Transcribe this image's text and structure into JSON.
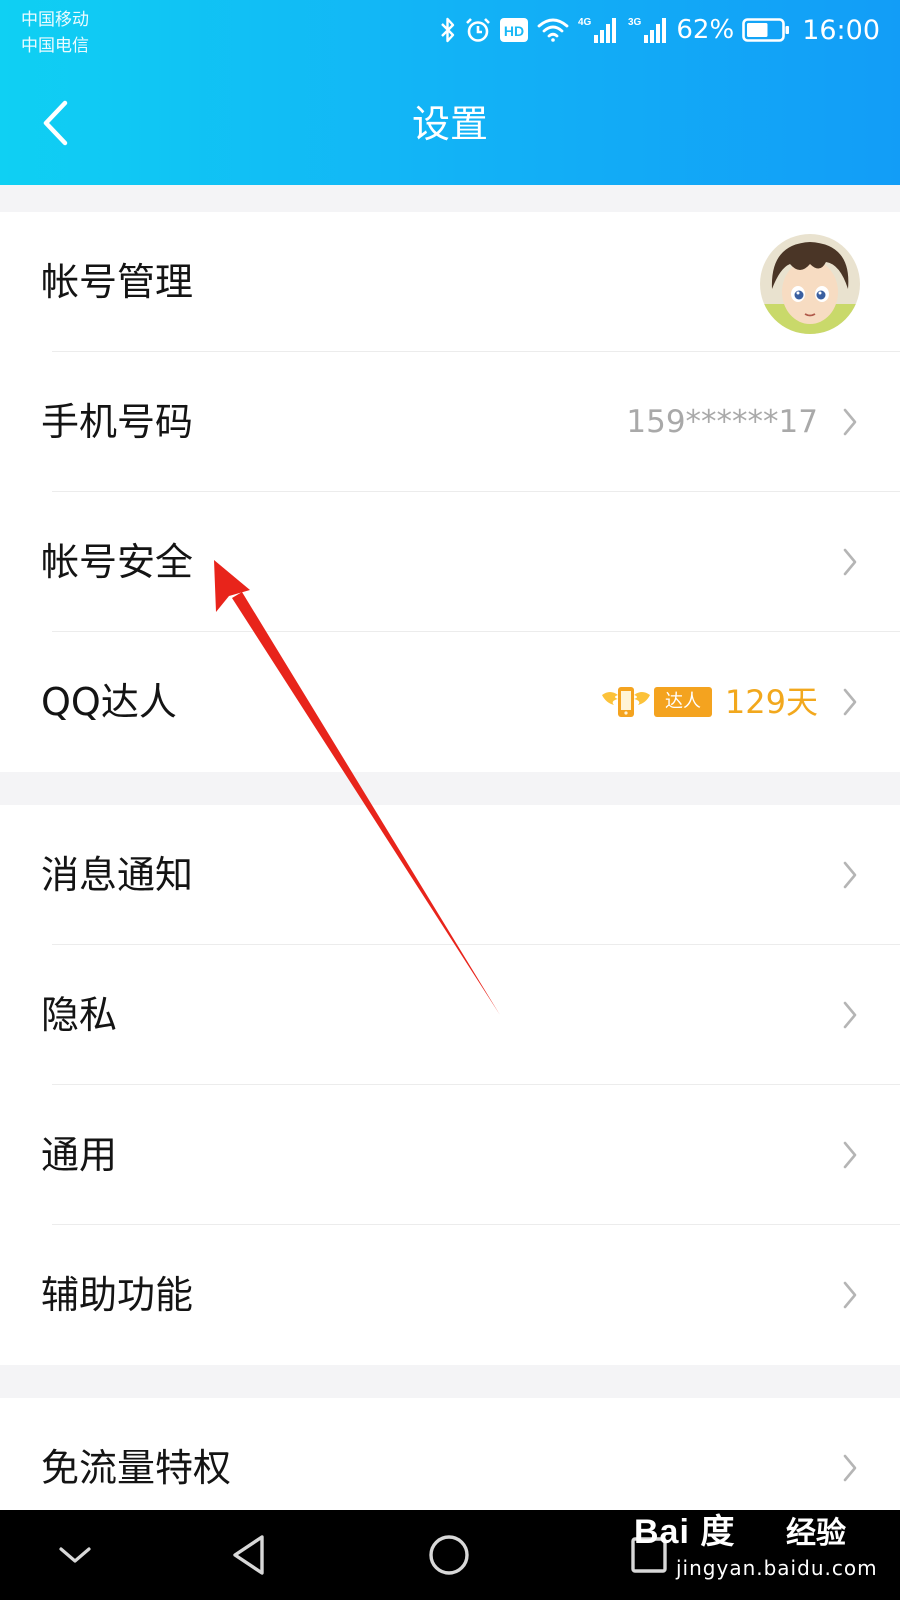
{
  "status_bar": {
    "carrier_1": "中国移动",
    "carrier_2": "中国电信",
    "hd_label": "HD",
    "net_1": "4G",
    "net_2": "3G",
    "battery": "62%",
    "time": "16:00",
    "icons": [
      "bluetooth-icon",
      "alarm-icon",
      "hd-icon",
      "wifi-icon",
      "signal-4g-icon",
      "signal-3g-icon",
      "battery-icon"
    ]
  },
  "header": {
    "title": "设置",
    "back_icon": "chevron-left-icon",
    "color_start": "#0fd0f3",
    "color_end": "#129df7"
  },
  "group_1": {
    "items": [
      {
        "label": "帐号管理",
        "trailing": "avatar"
      },
      {
        "label": "手机号码",
        "value": "159******17",
        "icon": "chevron-right-icon"
      },
      {
        "label": "帐号安全",
        "icon": "chevron-right-icon"
      },
      {
        "label": "QQ达人",
        "badge": "达人",
        "badge_icon": "winged-phone-icon",
        "value": "129天",
        "icon": "chevron-right-icon"
      }
    ]
  },
  "group_2": {
    "items": [
      {
        "label": "消息通知",
        "icon": "chevron-right-icon"
      },
      {
        "label": "隐私",
        "icon": "chevron-right-icon"
      },
      {
        "label": "通用",
        "icon": "chevron-right-icon"
      },
      {
        "label": "辅助功能",
        "icon": "chevron-right-icon"
      }
    ]
  },
  "group_3": {
    "items": [
      {
        "label": "免流量特权",
        "icon": "chevron-right-icon"
      }
    ]
  },
  "navbar": {
    "icons": [
      "collapse-chevron-icon",
      "back-triangle-icon",
      "home-circle-icon",
      "recents-square-icon"
    ]
  },
  "watermark": {
    "brand": "Bai 度",
    "suffix": "经验",
    "url": "jingyan.baidu.com"
  },
  "colors": {
    "accent_orange": "#f2a81d",
    "annotation_red": "#e8241b",
    "value_gray": "#a9a9a9",
    "divider": "#ececec",
    "page_bg": "#f4f4f6"
  }
}
